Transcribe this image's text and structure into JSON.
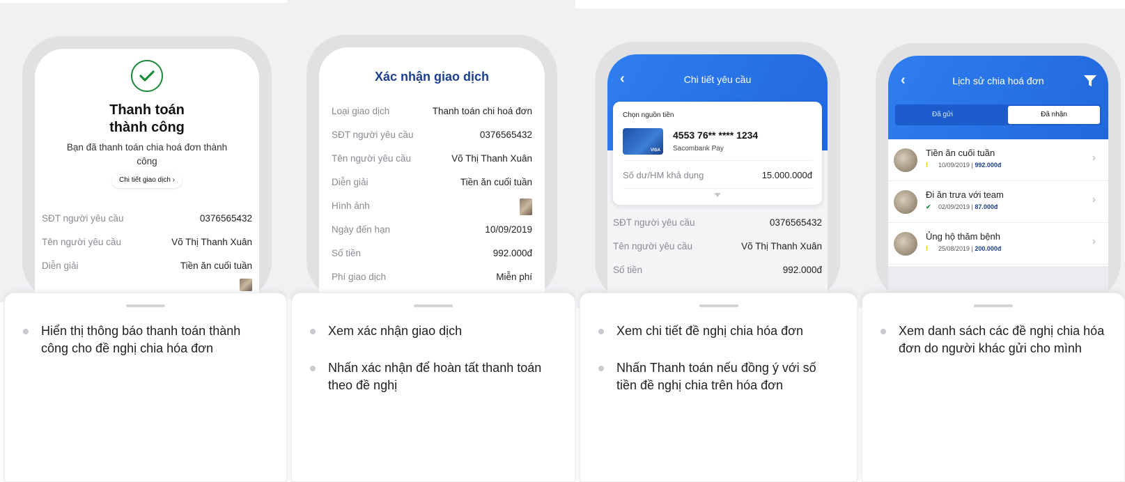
{
  "panel1": {
    "title": "Thanh toán\nthành công",
    "message": "Bạn đã thanh toán chia hoá đơn thành công",
    "detail_link": "Chi tiết giao dịch  ›",
    "rows": [
      {
        "k": "SĐT người yêu cầu",
        "v": "0376565432"
      },
      {
        "k": "Tên người yêu cầu",
        "v": "Võ Thị Thanh Xuân"
      },
      {
        "k": "Diễn giải",
        "v": "Tiền ăn cuối tuần"
      }
    ],
    "bullets": [
      "Hiển thị thông báo thanh toán thành công cho đề nghị chia hóa đơn"
    ]
  },
  "panel2": {
    "title": "Xác nhận giao dịch",
    "rows": [
      {
        "k": "Loại giao dịch",
        "v": "Thanh toán chi hoá đơn"
      },
      {
        "k": "SĐT người yêu cầu",
        "v": "0376565432"
      },
      {
        "k": "Tên người yêu cầu",
        "v": "Võ Thị Thanh Xuân"
      },
      {
        "k": "Diễn giải",
        "v": "Tiền ăn cuối tuần"
      },
      {
        "k": "Hình ảnh",
        "v": ""
      },
      {
        "k": "Ngày đến hạn",
        "v": "10/09/2019"
      },
      {
        "k": "Số tiền",
        "v": "992.000đ"
      },
      {
        "k": "Phí giao dịch",
        "v": "Miễn phí"
      }
    ],
    "bullets": [
      "Xem xác nhận giao dịch",
      "Nhấn xác nhận để hoàn tất thanh toán theo đề nghị"
    ]
  },
  "panel3": {
    "title": "Chi tiết yêu cầu",
    "source_label": "Chọn nguồn tiền",
    "card_number": "4553 76** **** 1234",
    "card_bank": "Sacombank Pay",
    "card_brand": "VISA",
    "balance_label": "Số dư/HM khả dụng",
    "balance_value": "15.000.000đ",
    "rows": [
      {
        "k": "SĐT người yêu cầu",
        "v": "0376565432"
      },
      {
        "k": "Tên người yêu cầu",
        "v": "Võ Thị Thanh Xuân"
      },
      {
        "k": "Số tiền",
        "v": "992.000đ"
      }
    ],
    "bullets": [
      "Xem chi tiết đề nghị chia hóa đơn",
      "Nhấn Thanh toán nếu đồng ý với số tiền đề nghị chia trên hóa đơn"
    ]
  },
  "panel4": {
    "title": "Lịch sử chia hoá đơn",
    "tabs": [
      "Đã gửi",
      "Đã nhận"
    ],
    "items": [
      {
        "title": "Tiền ăn cuối tuần",
        "status": "!",
        "date": "10/09/2019",
        "amount": "992.000đ",
        "status_color": "#f2b200"
      },
      {
        "title": "Đi ăn trưa với team",
        "status": "✔",
        "date": "02/09/2019",
        "amount": "87.000đ",
        "status_color": "#1e8a3c"
      },
      {
        "title": "Ủng hộ thăm bệnh",
        "status": "!",
        "date": "25/08/2019",
        "amount": "200.000đ",
        "status_color": "#f2b200"
      }
    ],
    "bullets": [
      "Xem danh sách các đề nghị chia hóa đơn do người khác gửi cho mình"
    ]
  },
  "colors": {
    "brand_blue": "#2f7ef0",
    "success_green": "#1e8a3c",
    "title_navy": "#1c3f8f"
  }
}
